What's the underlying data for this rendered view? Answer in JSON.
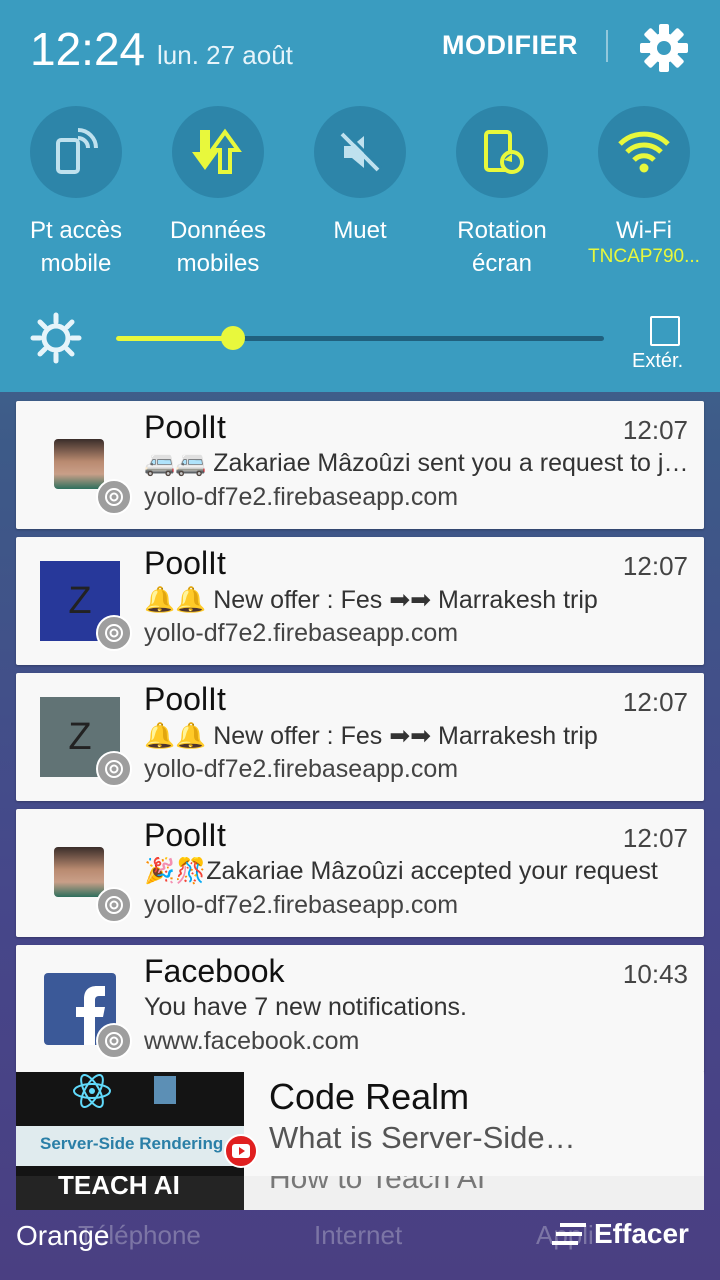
{
  "status": {
    "time": "12:24",
    "date": "lun. 27 août",
    "modifier_label": "MODIFIER"
  },
  "quick_tiles": [
    {
      "label": "Pt accès mobile",
      "icon": "hotspot-icon",
      "state": "off"
    },
    {
      "label": "Données mobiles",
      "icon": "mobile-data-icon",
      "state": "on"
    },
    {
      "label": "Muet",
      "icon": "mute-icon",
      "state": "off"
    },
    {
      "label": "Rotation écran",
      "icon": "rotation-icon",
      "state": "on"
    },
    {
      "label": "Wi-Fi",
      "sub": "TNCAP790...",
      "icon": "wifi-icon",
      "state": "on"
    }
  ],
  "brightness": {
    "level": 0.24,
    "outdoor_label": "Extér."
  },
  "colors": {
    "panel": "#3a9cc0",
    "accent": "#e8f83c",
    "tile": "#2d85a9"
  },
  "notifications": [
    {
      "app": "PoolIt",
      "time": "12:07",
      "message": "🚐🚐 Zakariae Mâzoûzi  sent you a request to join your trip",
      "source": "yollo-df7e2.firebaseapp.com",
      "icon": "avatar-photo"
    },
    {
      "app": "PoolIt",
      "time": "12:07",
      "message": "🔔🔔 New offer :  Fes     ➡➡ Marrakesh trip",
      "source": "yollo-df7e2.firebaseapp.com",
      "icon": "z-blue",
      "letter": "Z"
    },
    {
      "app": "PoolIt",
      "time": "12:07",
      "message": "🔔🔔 New offer :  Fes     ➡➡ Marrakesh trip",
      "source": "yollo-df7e2.firebaseapp.com",
      "icon": "z-grey",
      "letter": "Z"
    },
    {
      "app": "PoolIt",
      "time": "12:07",
      "message": "🎉🎊Zakariae Mâzoûzi accepted your request",
      "source": "yollo-df7e2.firebaseapp.com",
      "icon": "avatar-photo"
    },
    {
      "app": "Facebook",
      "time": "10:43",
      "message": "You have 7 new notifications.",
      "source": "www.facebook.com",
      "icon": "facebook-logo"
    }
  ],
  "youtube": {
    "channel": "Code Realm",
    "title": "What is Server-Side…",
    "thumb_text": "Server-Side Rendering",
    "next_title": "How to Teach AI",
    "next_thumb_text": "TEACH AI"
  },
  "bottom": {
    "carrier": "Orange",
    "dock": [
      "Téléphone",
      "Internet",
      "Appli"
    ],
    "clear_label": "Effacer"
  }
}
